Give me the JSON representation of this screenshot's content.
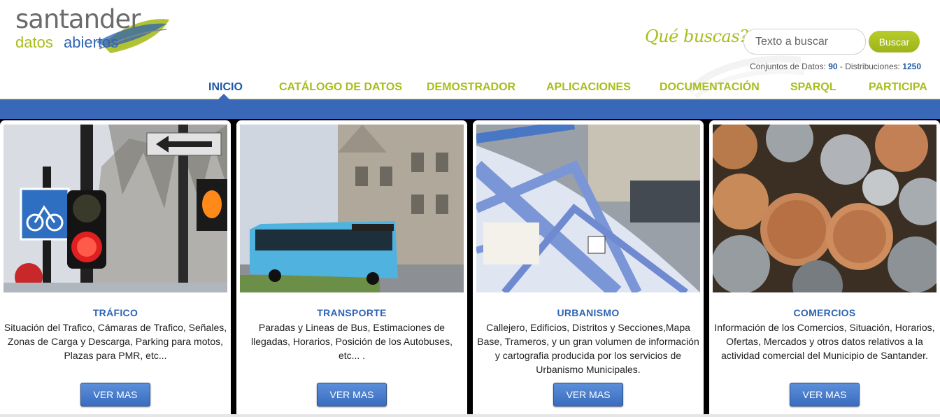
{
  "logo": {
    "brand": "santander",
    "sub_datos": "datos",
    "sub_abiertos": "abiertos"
  },
  "search": {
    "prompt": "Qué buscas?",
    "placeholder": "Texto a buscar",
    "button": "Buscar"
  },
  "stats": {
    "datasets_label": "Conjuntos de Datos:",
    "datasets_count": "90",
    "separator": "-",
    "distributions_label": "Distribuciones:",
    "distributions_count": "1250"
  },
  "nav": {
    "items": [
      {
        "label": "INICIO",
        "active": true
      },
      {
        "label": "CATÁLOGO DE DATOS"
      },
      {
        "label": "DEMOSTRADOR"
      },
      {
        "label": "APLICACIONES"
      },
      {
        "label": "DOCUMENTACIÓN"
      },
      {
        "label": "SPARQL"
      },
      {
        "label": "PARTICIPA"
      }
    ]
  },
  "cards": [
    {
      "title": "TRÁFICO",
      "desc": "Situación del Trafico, Cámaras de Trafico, Señales, Zonas de Carga y Descarga, Parking para motos, Plazas para PMR, etc...",
      "button": "VER MAS",
      "image": "traffic-light-photo"
    },
    {
      "title": "TRANSPORTE",
      "desc": "Paradas y Lineas de Bus, Estimaciones de llegadas, Horarios, Posición de los Autobuses, etc... .",
      "button": "VER MAS",
      "image": "bus-photo"
    },
    {
      "title": "URBANISMO",
      "desc": "Callejero, Edificios, Distritos y Secciones,Mapa Base, Trameros, y un gran volumen de información y cartografia producida por los servicios de Urbanismo Municipales.",
      "button": "VER MAS",
      "image": "city-map-photo"
    },
    {
      "title": "COMERCIOS",
      "desc": "Información de los Comercios, Situación, Horarios, Ofertas, Mercados y otros datos relativos a la actividad comercial del Municipio de Santander.",
      "button": "VER MAS",
      "image": "coins-photo"
    }
  ],
  "colors": {
    "green": "#a9bd1c",
    "blue": "#2e63b3",
    "band": "#3a68b8"
  }
}
